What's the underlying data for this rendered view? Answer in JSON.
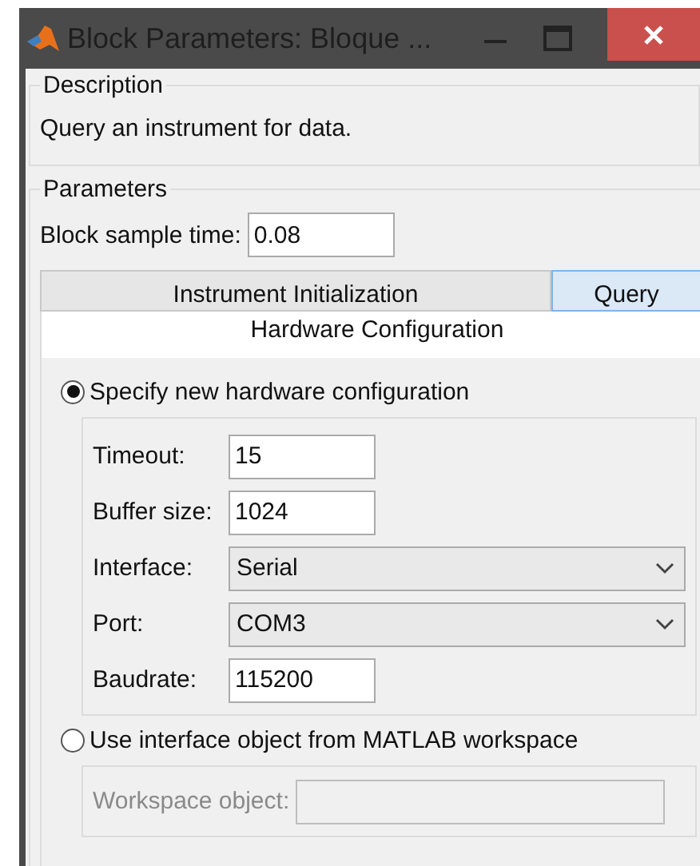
{
  "window": {
    "title": "Block Parameters: Bloque ..."
  },
  "description": {
    "legend": "Description",
    "text": "Query an instrument for data."
  },
  "parameters": {
    "legend": "Parameters",
    "sample_time": {
      "label": "Block sample time:",
      "value": "0.08"
    }
  },
  "tabs": [
    {
      "label": "Instrument Initialization",
      "selected": false
    },
    {
      "label": "Query",
      "selected": true
    }
  ],
  "panel": {
    "title": "Hardware Configuration",
    "options": [
      {
        "label": "Specify new hardware configuration",
        "selected": true,
        "disabled": false,
        "fields": [
          {
            "kind": "text",
            "label": "Timeout:",
            "value": "15"
          },
          {
            "kind": "text",
            "label": "Buffer size:",
            "value": "1024"
          },
          {
            "kind": "dropdown",
            "label": "Interface:",
            "value": "Serial"
          },
          {
            "kind": "dropdown",
            "label": "Port:",
            "value": "COM3"
          },
          {
            "kind": "text",
            "label": "Baudrate:",
            "value": "115200"
          }
        ]
      },
      {
        "label": "Use interface object from MATLAB workspace",
        "selected": false,
        "disabled": true,
        "fields": [
          {
            "kind": "wide",
            "label": "Workspace object:"
          }
        ]
      }
    ]
  }
}
